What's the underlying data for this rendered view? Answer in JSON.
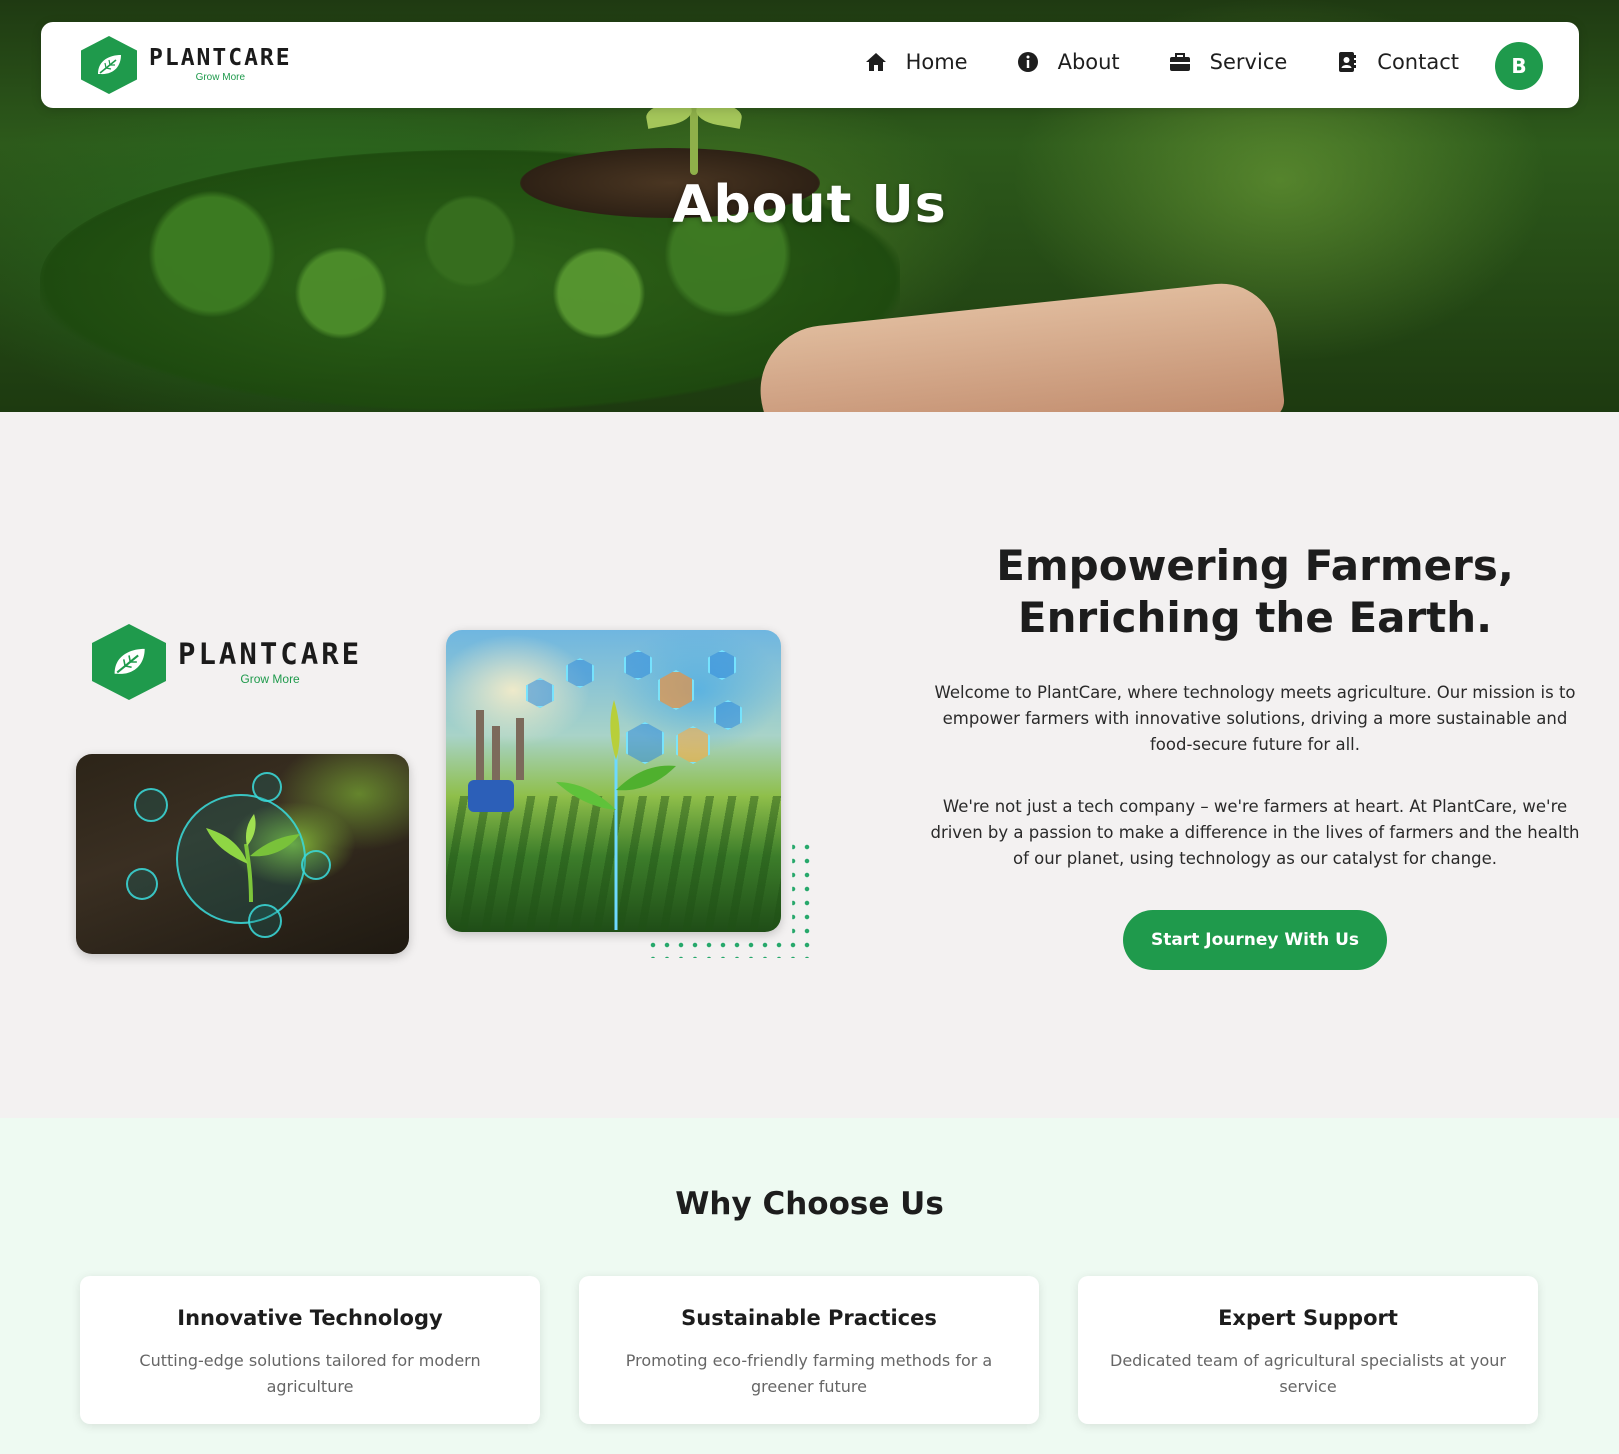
{
  "brand": {
    "name": "PLANTCARE",
    "tagline": "Grow More",
    "accent_color": "#1f9a4c"
  },
  "nav": {
    "items": [
      {
        "label": "Home",
        "icon": "home-icon"
      },
      {
        "label": "About",
        "icon": "info-icon"
      },
      {
        "label": "Service",
        "icon": "briefcase-icon"
      },
      {
        "label": "Contact",
        "icon": "contact-book-icon"
      }
    ],
    "avatar_initial": "B"
  },
  "hero": {
    "title": "About Us"
  },
  "about": {
    "heading_line1": "Empowering Farmers,",
    "heading_line2": "Enriching the Earth.",
    "paragraph1": "Welcome to PlantCare, where technology meets agriculture. Our mission is to empower farmers with innovative solutions, driving a more sustainable and food-secure future for all.",
    "paragraph2": "We're not just a tech company – we're farmers at heart. At PlantCare, we're driven by a passion to make a difference in the lives of farmers and the health of our planet, using technology as our catalyst for change.",
    "cta_label": "Start Journey With Us"
  },
  "why": {
    "title": "Why Choose Us",
    "cards": [
      {
        "title": "Innovative Technology",
        "description": "Cutting-edge solutions tailored for modern agriculture"
      },
      {
        "title": "Sustainable Practices",
        "description": "Promoting eco-friendly farming methods for a greener future"
      },
      {
        "title": "Expert Support",
        "description": "Dedicated team of agricultural specialists at your service"
      }
    ]
  }
}
